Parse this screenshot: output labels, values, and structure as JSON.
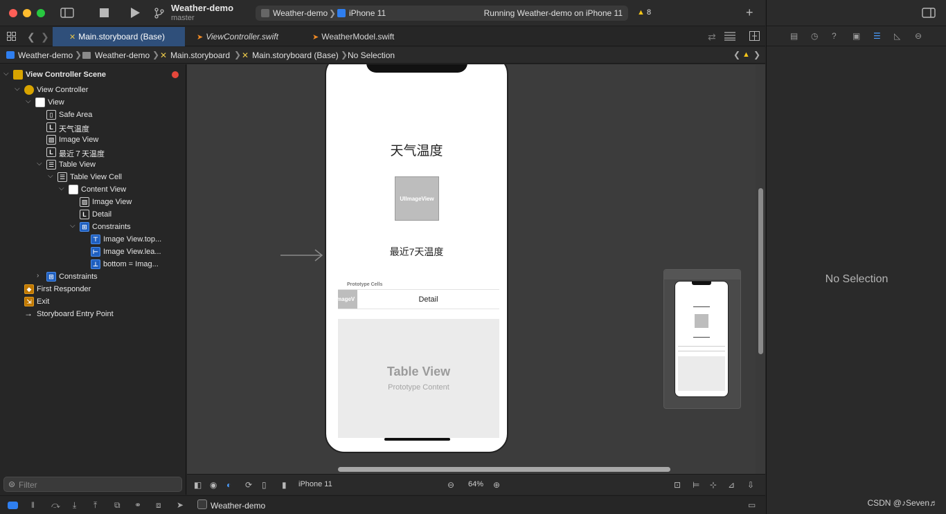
{
  "toolbar": {
    "project_name": "Weather-demo",
    "branch": "master",
    "scheme": "Weather-demo",
    "device": "iPhone 11",
    "status": "Running Weather-demo on iPhone 11",
    "warning_count": "8"
  },
  "tabs": [
    {
      "label": "Main.storyboard (Base)",
      "active": true
    },
    {
      "label": "ViewController.swift",
      "active": false
    },
    {
      "label": "WeatherModel.swift",
      "active": false
    }
  ],
  "jumpbar": {
    "items": [
      "Weather-demo",
      "Weather-demo",
      "Main.storyboard",
      "Main.storyboard (Base)",
      "No Selection"
    ]
  },
  "navigator": {
    "rows": [
      {
        "label": "View Controller Scene",
        "icon": "L",
        "indent": 0
      },
      {
        "label": "View Controller",
        "icon": "",
        "indent": 1
      },
      {
        "label": "View",
        "icon": "",
        "indent": 2
      },
      {
        "label": "Safe Area",
        "icon": "",
        "indent": 3
      },
      {
        "label": "天气温度",
        "icon": "L",
        "indent": 3
      },
      {
        "label": "Image View",
        "icon": "",
        "indent": 3
      },
      {
        "label": "最近７天温度",
        "icon": "L",
        "indent": 3
      },
      {
        "label": "Table View",
        "icon": "",
        "indent": 3
      },
      {
        "label": "Table View Cell",
        "icon": "",
        "indent": 4
      },
      {
        "label": "Content View",
        "icon": "",
        "indent": 5
      },
      {
        "label": "Image View",
        "icon": "",
        "indent": 6
      },
      {
        "label": "Detail",
        "icon": "L",
        "indent": 6
      },
      {
        "label": "Constraints",
        "icon": "",
        "indent": 6
      },
      {
        "label": "Image View.top...",
        "icon": "",
        "indent": 7
      },
      {
        "label": "Image View.lea...",
        "icon": "",
        "indent": 7
      },
      {
        "label": "bottom = Imag...",
        "icon": "",
        "indent": 7
      },
      {
        "label": "Constraints",
        "icon": "",
        "indent": 3
      },
      {
        "label": "First Responder",
        "icon": "",
        "indent": 1
      },
      {
        "label": "Exit",
        "icon": "",
        "indent": 1
      },
      {
        "label": "Storyboard Entry Point",
        "icon": "",
        "indent": 1
      }
    ],
    "filter_placeholder": "Filter"
  },
  "canvas": {
    "title_label": "天气温度",
    "image_placeholder": "UIImageView",
    "subtitle_label": "最近7天温度",
    "prototype_cells": "Prototype Cells",
    "cell_image": "mageV",
    "cell_detail": "Detail",
    "table_title": "Table View",
    "table_sub": "Prototype Content"
  },
  "canvas_bar": {
    "device": "iPhone 11",
    "zoom": "64%"
  },
  "debug": {
    "app_name": "Weather-demo"
  },
  "inspector": {
    "empty_text": "No Selection"
  },
  "watermark": "CSDN @♪Seven♬",
  "colors": {
    "accent": "#2f7ff0",
    "active_tab": "#2f4f7a",
    "warning": "#f5c518",
    "error": "#e5473b"
  }
}
